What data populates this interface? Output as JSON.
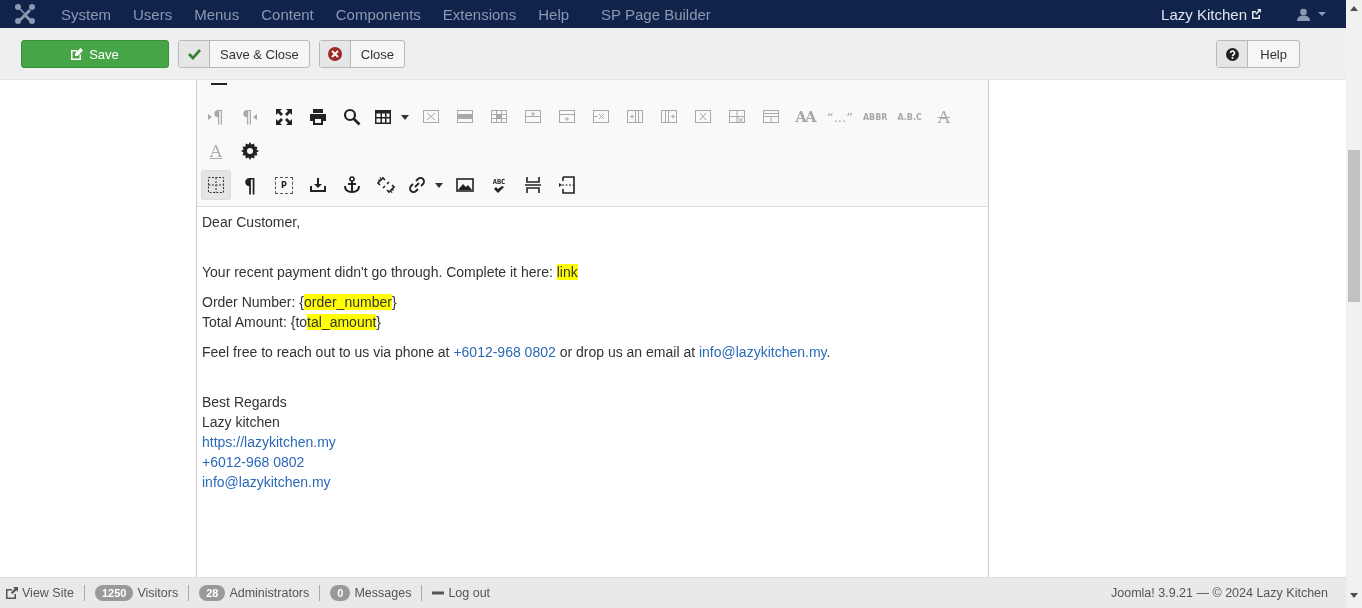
{
  "navbar": {
    "menu": [
      "System",
      "Users",
      "Menus",
      "Content",
      "Components",
      "Extensions",
      "Help",
      "SP Page Builder"
    ],
    "site_link": "Lazy Kitchen"
  },
  "toolbar": {
    "buttons": [
      {
        "label": "Save",
        "kind": "primary"
      },
      {
        "label": "Save & Close",
        "kind": "default"
      },
      {
        "label": "Close",
        "kind": "default"
      }
    ],
    "help": "Help"
  },
  "editor": {
    "toolbar_rows": [
      {
        "items": [
          {
            "kind": "text",
            "text": "¶",
            "disabled": true
          },
          {
            "kind": "text",
            "text": "¶",
            "disabled": true
          },
          {
            "kind": "icon",
            "disabled": false
          },
          {
            "kind": "icon",
            "disabled": false
          },
          {
            "kind": "icon",
            "disabled": false
          },
          {
            "kind": "icon",
            "disabled": false
          },
          {
            "kind": "icon",
            "disabled": true
          },
          {
            "kind": "icon",
            "disabled": true
          },
          {
            "kind": "icon",
            "disabled": true
          },
          {
            "kind": "icon",
            "disabled": true
          },
          {
            "kind": "icon",
            "disabled": true
          },
          {
            "kind": "icon",
            "disabled": true
          },
          {
            "kind": "icon",
            "disabled": true
          },
          {
            "kind": "icon",
            "disabled": true
          },
          {
            "kind": "icon",
            "disabled": true
          },
          {
            "kind": "icon",
            "disabled": true
          },
          {
            "kind": "icon",
            "disabled": true
          },
          {
            "kind": "text",
            "text": "AA",
            "disabled": true
          },
          {
            "kind": "text",
            "text": "“...”",
            "disabled": true
          },
          {
            "kind": "text",
            "text": "ABBR",
            "disabled": true
          },
          {
            "kind": "text",
            "text": "A.B.C",
            "disabled": true
          },
          {
            "kind": "text",
            "text": "A",
            "disabled": true
          }
        ]
      },
      {
        "items": [
          {
            "kind": "text",
            "text": "A",
            "disabled": true
          },
          {
            "kind": "icon",
            "disabled": false
          }
        ]
      },
      {
        "items": [
          {
            "kind": "icon",
            "disabled": false,
            "selected": true
          },
          {
            "kind": "text",
            "text": "¶",
            "disabled": false,
            "selected": false
          },
          {
            "kind": "text",
            "text": "P",
            "disabled": false,
            "selected": false
          },
          {
            "kind": "icon",
            "disabled": false,
            "selected": false
          },
          {
            "kind": "icon",
            "disabled": false,
            "selected": false
          },
          {
            "kind": "icon",
            "disabled": false,
            "selected": false
          },
          {
            "kind": "icon",
            "disabled": false,
            "selected": false
          },
          {
            "kind": "icon",
            "disabled": false,
            "selected": false
          },
          {
            "kind": "text",
            "text": "ABC",
            "disabled": false,
            "selected": false
          },
          {
            "kind": "icon",
            "disabled": false,
            "selected": false
          },
          {
            "kind": "icon",
            "disabled": false,
            "selected": false
          }
        ]
      }
    ],
    "paragraphs": [
      {
        "lines": [
          [
            {
              "kind": "plain",
              "text": "Dear Customer,"
            }
          ]
        ]
      },
      {
        "lines": [
          [
            {
              "kind": "plain",
              "text": "Your recent payment didn't go through. Complete it here: "
            },
            {
              "kind": "mark",
              "text": "link"
            }
          ]
        ]
      },
      {
        "lines": [
          [
            {
              "kind": "plain",
              "text": "Order Number: {"
            },
            {
              "kind": "mark",
              "text": "order_number"
            },
            {
              "kind": "plain",
              "text": "}"
            }
          ],
          [
            {
              "kind": "plain",
              "text": "Total Amount: {to"
            },
            {
              "kind": "mark",
              "text": "tal_amount"
            },
            {
              "kind": "plain",
              "text": "}"
            }
          ]
        ]
      },
      {
        "lines": [
          [
            {
              "kind": "plain",
              "text": "Feel free to reach out to us via phone at "
            },
            {
              "kind": "link",
              "text": "+6012-968 0802"
            },
            {
              "kind": "plain",
              "text": " or drop us an email at "
            },
            {
              "kind": "link",
              "text": "info@lazykitchen.my"
            },
            {
              "kind": "plain",
              "text": "."
            }
          ]
        ]
      },
      {
        "lines": [
          [
            {
              "kind": "plain",
              "text": "Best Regards"
            }
          ],
          [
            {
              "kind": "plain",
              "text": "Lazy kitchen"
            }
          ],
          [
            {
              "kind": "link",
              "text": "https://lazykitchen.my"
            }
          ],
          [
            {
              "kind": "link",
              "text": "+6012-968 0802"
            }
          ],
          [
            {
              "kind": "link",
              "text": "info@lazykitchen.my"
            }
          ]
        ]
      }
    ]
  },
  "status_bar": {
    "items": [
      {
        "kind": "link",
        "text": "View Site"
      },
      {
        "kind": "count",
        "count": "1250",
        "text": "Visitors"
      },
      {
        "kind": "count",
        "count": "28",
        "text": "Administrators"
      },
      {
        "kind": "count",
        "count": "0",
        "text": "Messages"
      },
      {
        "kind": "logout",
        "text": "Log out"
      }
    ],
    "footer": "Joomla! 3.9.21 — © 2024 Lazy Kitchen"
  }
}
